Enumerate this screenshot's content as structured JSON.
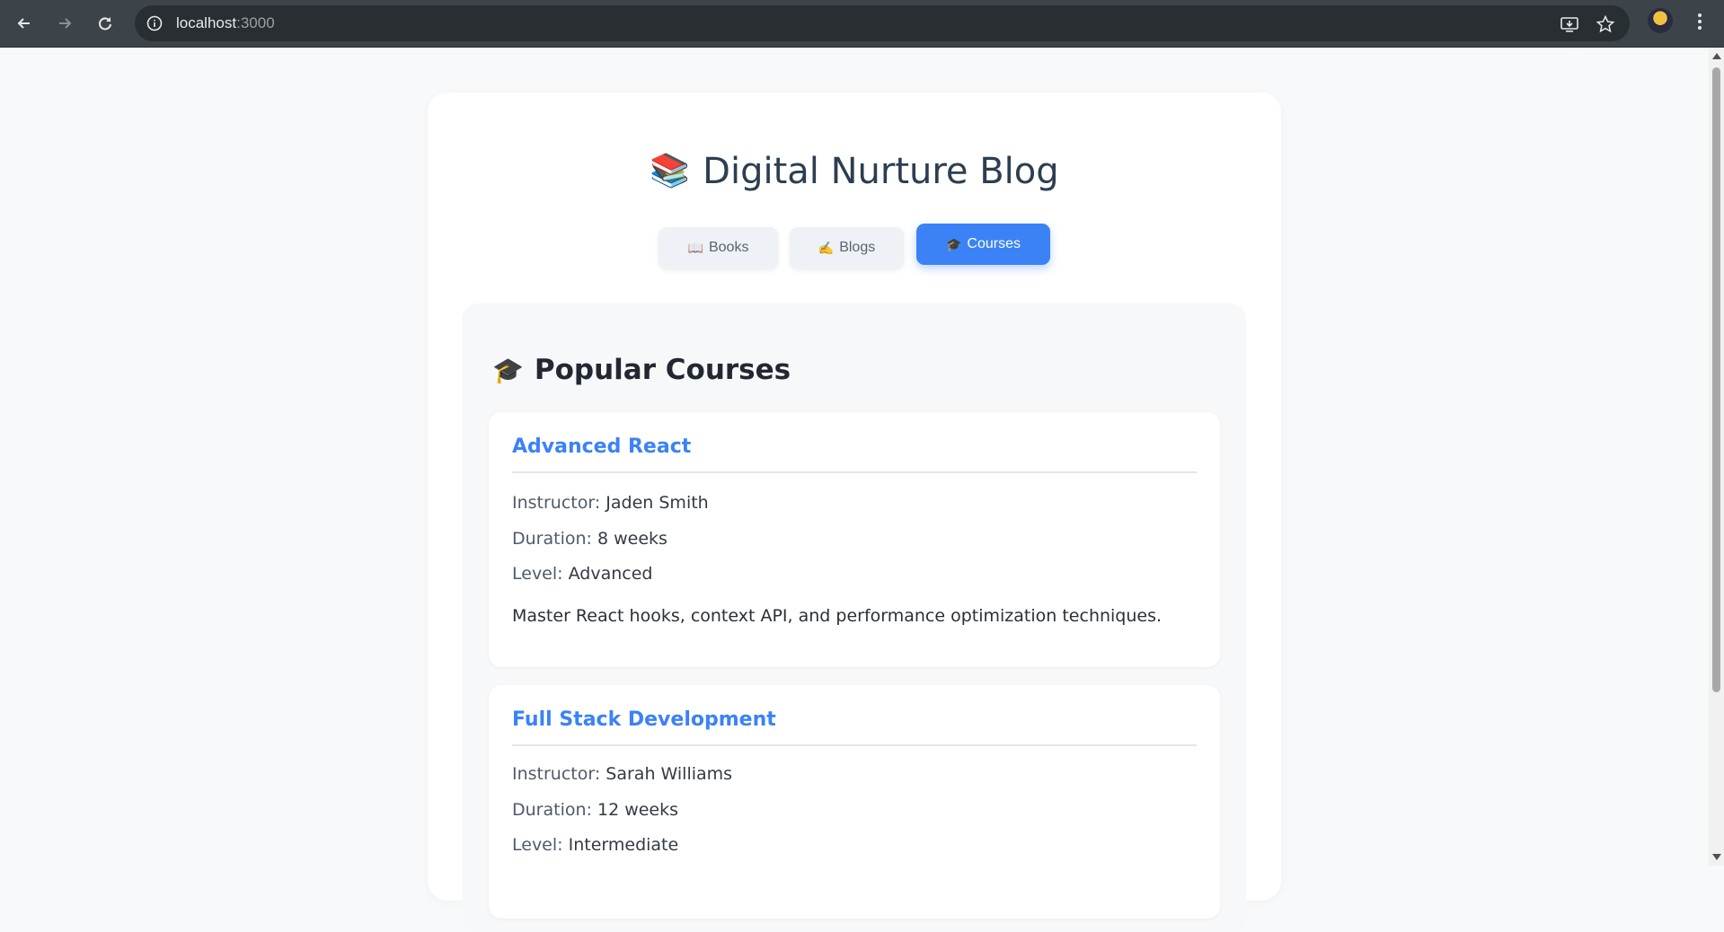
{
  "browser": {
    "url_host": "localhost",
    "url_port": ":3000",
    "icons": [
      "back-arrow-icon",
      "forward-arrow-icon",
      "reload-icon",
      "site-info-icon",
      "install-app-icon",
      "bookmark-star-icon",
      "profile-avatar",
      "more-menu-icon"
    ]
  },
  "site": {
    "title_emoji": "📚",
    "title": "Digital Nurture Blog"
  },
  "tabs": [
    {
      "emoji": "📖",
      "label": "Books",
      "active": false
    },
    {
      "emoji": "✍️",
      "label": "Blogs",
      "active": false
    },
    {
      "emoji": "🎓",
      "label": "Courses",
      "active": true
    }
  ],
  "section": {
    "emoji": "🎓",
    "title": "Popular Courses"
  },
  "labels": {
    "instructor": "Instructor:",
    "duration": "Duration:",
    "level": "Level:"
  },
  "courses": [
    {
      "title": "Advanced React",
      "instructor": "Jaden Smith",
      "duration": "8 weeks",
      "level": "Advanced",
      "description": "Master React hooks, context API, and performance optimization techniques."
    },
    {
      "title": "Full Stack Development",
      "instructor": "Sarah Williams",
      "duration": "12 weeks",
      "level": "Intermediate"
    }
  ],
  "colors": {
    "accent": "#3b82f6",
    "heading": "#2c3e50",
    "background": "#f8f9fb"
  }
}
